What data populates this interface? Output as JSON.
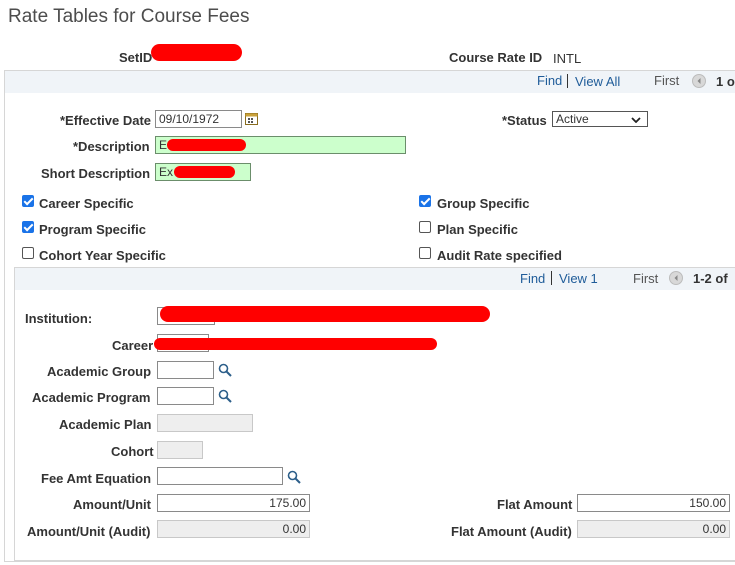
{
  "page_title": "Rate Tables for Course Fees",
  "header": {
    "setid_label": "SetID",
    "course_rate_id_label": "Course Rate ID",
    "course_rate_id_value": "INTL"
  },
  "outer_nav": {
    "find": "Find",
    "view_all": "View All",
    "first": "First",
    "range": "1 o"
  },
  "form": {
    "effective_date_label": "*Effective Date",
    "effective_date_value": "09/10/1972",
    "status_label": "*Status",
    "status_value": "Active",
    "description_label": "*Description",
    "description_value": "E",
    "short_description_label": "Short Description",
    "short_description_value": "Ex"
  },
  "checkboxes": {
    "career_specific": {
      "label": "Career Specific",
      "checked": true
    },
    "group_specific": {
      "label": "Group Specific",
      "checked": true
    },
    "program_specific": {
      "label": "Program Specific",
      "checked": true
    },
    "plan_specific": {
      "label": "Plan Specific",
      "checked": false
    },
    "cohort_year_specific": {
      "label": "Cohort Year Specific",
      "checked": false
    },
    "audit_rate_specified": {
      "label": "Audit Rate specified",
      "checked": false
    }
  },
  "inner_nav": {
    "find": "Find",
    "view_1": "View 1",
    "first": "First",
    "range": "1-2 of"
  },
  "detail": {
    "institution_label": "Institution:",
    "career_label": "Career",
    "academic_group_label": "Academic Group",
    "academic_program_label": "Academic Program",
    "academic_plan_label": "Academic Plan",
    "cohort_label": "Cohort",
    "fee_amt_equation_label": "Fee Amt Equation",
    "amount_unit_label": "Amount/Unit",
    "amount_unit_value": "175.00",
    "flat_amount_label": "Flat Amount",
    "flat_amount_value": "150.00",
    "amount_unit_audit_label": "Amount/Unit (Audit)",
    "amount_unit_audit_value": "0.00",
    "flat_amount_audit_label": "Flat Amount (Audit)",
    "flat_amount_audit_value": "0.00"
  },
  "colors": {
    "accent_checkbox": "#1a73e8",
    "required_field_bg": "#ccffcc",
    "link": "#1f5c99",
    "redaction": "#ff0000"
  }
}
